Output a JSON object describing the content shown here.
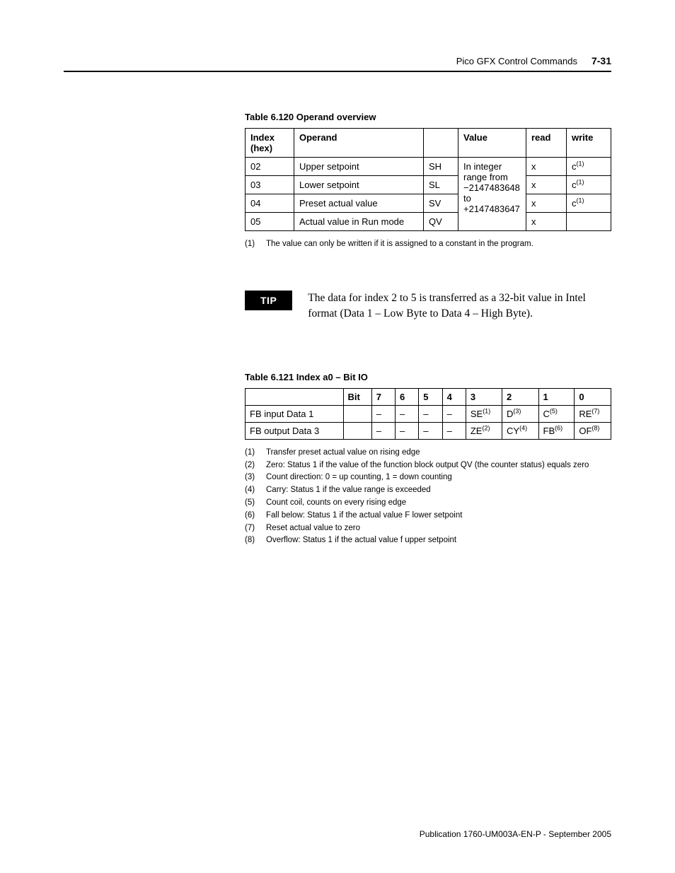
{
  "header": {
    "title": "Pico GFX Control Commands",
    "page": "7-31"
  },
  "table1": {
    "title": "Table 6.120 Operand overview",
    "head": {
      "index": "Index (hex)",
      "operand": "Operand",
      "value": "Value",
      "read": "read",
      "write": "write"
    },
    "value_text": {
      "l1": "In integer range from",
      "l2": "−2147483648 to",
      "l3": "+2147483647"
    },
    "rows": [
      {
        "idx": "02",
        "op": "Upper setpoint",
        "sym": "SH",
        "read": "x",
        "write_base": "c",
        "write_sup": "(1)"
      },
      {
        "idx": "03",
        "op": "Lower setpoint",
        "sym": "SL",
        "read": "x",
        "write_base": "c",
        "write_sup": "(1)"
      },
      {
        "idx": "04",
        "op": "Preset actual value",
        "sym": "SV",
        "read": "x",
        "write_base": "c",
        "write_sup": "(1)"
      },
      {
        "idx": "05",
        "op": "Actual value in Run mode",
        "sym": "QV",
        "read": "x",
        "write_base": "",
        "write_sup": ""
      }
    ],
    "footnote": {
      "n": "(1)",
      "t": "The value can only be written if it is assigned to a constant in the program."
    }
  },
  "tip": {
    "label": "TIP",
    "text": "The data for index 2 to 5 is transferred as a 32-bit value in Intel format (Data 1 – Low Byte to Data 4 – High Byte)."
  },
  "table2": {
    "title": "Table 6.121 Index a0 – Bit IO",
    "head": {
      "bit": "Bit",
      "b7": "7",
      "b6": "6",
      "b5": "5",
      "b4": "4",
      "b3": "3",
      "b2": "2",
      "b1": "1",
      "b0": "0"
    },
    "rows": [
      {
        "label": "FB input Data 1",
        "c7": "–",
        "c6": "–",
        "c5": "–",
        "c4": "–",
        "c3": {
          "b": "SE",
          "s": "(1)"
        },
        "c2": {
          "b": "D",
          "s": "(3)"
        },
        "c1": {
          "b": "C",
          "s": "(5)"
        },
        "c0": {
          "b": "RE",
          "s": "(7)"
        }
      },
      {
        "label": "FB output Data 3",
        "c7": "–",
        "c6": "–",
        "c5": "–",
        "c4": "–",
        "c3": {
          "b": "ZE",
          "s": "(2)"
        },
        "c2": {
          "b": "CY",
          "s": "(4)"
        },
        "c1": {
          "b": "FB",
          "s": "(6)"
        },
        "c0": {
          "b": "OF",
          "s": "(8)"
        }
      }
    ],
    "footnotes": [
      {
        "n": "(1)",
        "t": "Transfer preset actual value on rising edge"
      },
      {
        "n": "(2)",
        "t": "Zero: Status 1 if the value of the function block output QV (the counter status) equals zero"
      },
      {
        "n": "(3)",
        "t": "Count direction: 0 = up counting, 1 = down counting"
      },
      {
        "n": "(4)",
        "t": "Carry: Status 1 if the value range is exceeded"
      },
      {
        "n": "(5)",
        "t": "Count coil, counts on every rising edge"
      },
      {
        "n": "(6)",
        "t": "Fall below: Status 1 if the actual value F lower setpoint"
      },
      {
        "n": "(7)",
        "t": "Reset actual value to zero"
      },
      {
        "n": "(8)",
        "t": "Overflow: Status 1 if the actual value f upper setpoint"
      }
    ]
  },
  "footer": "Publication 1760-UM003A-EN-P - September 2005"
}
